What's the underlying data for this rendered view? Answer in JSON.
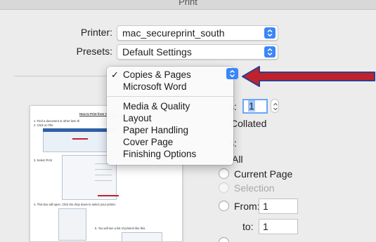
{
  "window": {
    "title": "Print"
  },
  "printer": {
    "label": "Printer:",
    "value": "mac_secureprint_south"
  },
  "presets": {
    "label": "Presets:",
    "value": "Default Settings"
  },
  "section_menu": {
    "items": [
      {
        "label": "Copies & Pages",
        "checked": true
      },
      {
        "label": "Microsoft Word",
        "checked": false
      },
      {
        "label": "Media & Quality",
        "checked": false
      },
      {
        "label": "Layout",
        "checked": false
      },
      {
        "label": "Paper Handling",
        "checked": false
      },
      {
        "label": "Cover Page",
        "checked": false
      },
      {
        "label": "Finishing Options",
        "checked": false
      }
    ],
    "check_glyph": "✓"
  },
  "copies": {
    "label": "s:",
    "value": "1"
  },
  "collated": {
    "label": "Collated"
  },
  "pages": {
    "label": "s:",
    "all_label": "All",
    "current_page_label": "Current Page",
    "selection_label": "Selection",
    "from_label": "From:",
    "from_value": "1",
    "to_label": "to:",
    "to_value": "1"
  },
  "preview_doc": {
    "title": "How to Print from Your New",
    "step1": "1.  Find a document or other item th",
    "step2": "2.  Click on File",
    "step3": "3.  Select Print",
    "step4": "4.  This box will open. Click the drop down to select your printer.",
    "step5": "5.      You will see a list of printers like this."
  },
  "colors": {
    "accent": "#3b86f7",
    "annotation_arrow": "#c0222b",
    "arrow_outline": "#2d3f8f"
  }
}
